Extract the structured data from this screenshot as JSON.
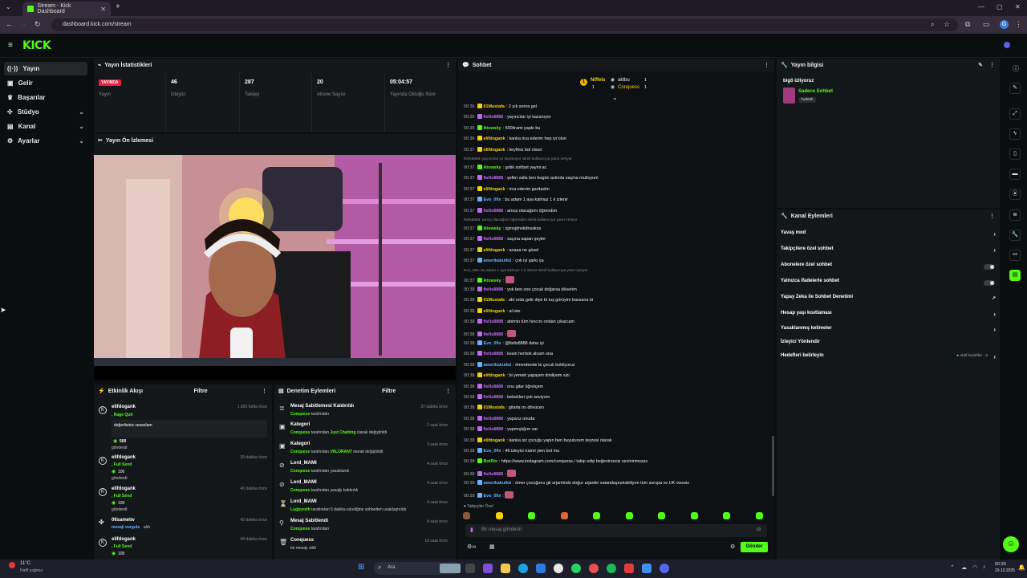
{
  "browser": {
    "tab_title": "Stream - Kick Dashboard",
    "url": "dashboard.kick.com/stream",
    "profile_initial": "G"
  },
  "logo": "KICK",
  "sidebar": {
    "items": [
      {
        "label": "Yayın",
        "icon": "broadcast-icon",
        "active": true
      },
      {
        "label": "Gelir",
        "icon": "wallet-icon"
      },
      {
        "label": "Başarılar",
        "icon": "trophy-icon"
      },
      {
        "label": "Stüdyo",
        "icon": "studio-icon",
        "expandable": true
      },
      {
        "label": "Kanal",
        "icon": "channel-icon",
        "expandable": true
      },
      {
        "label": "Ayarlar",
        "icon": "gear-icon",
        "expandable": true
      }
    ]
  },
  "stats": {
    "title": "Yayın İstatistikleri",
    "items": [
      {
        "value": "YAYINDA",
        "label": "Yayın"
      },
      {
        "value": "46",
        "label": "İzleyici"
      },
      {
        "value": "287",
        "label": "Takipçi"
      },
      {
        "value": "20",
        "label": "Abone Sayısı"
      },
      {
        "value": "05:04:57",
        "label": "Yayında Olduğu Süre"
      }
    ]
  },
  "preview": {
    "title": "Yayın Ön İzlemesi"
  },
  "activity": {
    "title": "Etkinlik Akışı",
    "filter": "Filtre",
    "items": [
      {
        "name": "elifdogank",
        "sub": ", Rage Quit",
        "time": "1.920 hafta önce",
        "msg": "değerlisiniz vesselam",
        "amount": "500",
        "sent": "gönderdi"
      },
      {
        "name": "elifdogank",
        "sub": ", Full Send",
        "time": "39 dakika önce",
        "amount": "100",
        "sent": "gönderdi"
      },
      {
        "name": "elifdogank",
        "sub": ", Full Send",
        "time": "40 dakika önce",
        "amount": "100",
        "sent": "gönderdi"
      },
      {
        "name": "06sametw",
        "sub": "mesaji vurgula",
        "sub2": "aldı",
        "time": "42 dakika önce"
      },
      {
        "name": "elifdogank",
        "sub": ", Full Send",
        "time": "44 dakika önce",
        "amount": "100"
      }
    ]
  },
  "mod": {
    "title": "Denetim Eylemleri",
    "filter": "Filtre",
    "items": [
      {
        "title": "Mesaj Sabitlemesi Kaldırıldı",
        "actor": "Conquess",
        "desc": " tarafından",
        "time": "37 dakika önce"
      },
      {
        "title": "Kategori",
        "actor": "Conquess",
        "desc": " tarafından ",
        "hl": "Just Chatting",
        "desc2": " olarak değiştirildi",
        "time": "1 saat önce"
      },
      {
        "title": "Kategori",
        "actor": "Conquess",
        "desc": " tarafından ",
        "hl": "VALORANT",
        "desc2": " olarak değiştirildi",
        "time": "3 saat önce"
      },
      {
        "title": "Lord_MAMI",
        "actor": "Conquess",
        "desc": " tarafından yasaklandı",
        "time": "4 saat önce"
      },
      {
        "title": "Lord_MAMI",
        "actor": "Conquess",
        "desc": " tarafından yasağı kaldırıldı",
        "time": "4 saat önce"
      },
      {
        "title": "Lord_MAMI",
        "actor": "Lugbureth",
        "desc": " tarafından 5 dakika süreliğine sohbetten uzaklaştırıldı",
        "time": "4 saat önce"
      },
      {
        "title": "Mesaj Sabitlendi",
        "actor": "Conquess",
        "desc": " tarafından",
        "time": "4 saat önce"
      },
      {
        "title": "Conquess",
        "actor": "",
        "desc": "bir mesajı sildi",
        "time": "10 saat önce"
      }
    ]
  },
  "chat": {
    "title": "Sohbet",
    "top_users": [
      {
        "name": "Niffels",
        "count": "1"
      },
      {
        "name": "aktbu",
        "count": "1"
      },
      {
        "name": "Conquess",
        "count": "1"
      }
    ],
    "followers_only_label": "Takipçiler Özel",
    "input_placeholder": "Bir mesaj gönderin",
    "send_label": "Gönder",
    "messages": [
      {
        "ts": "00:36",
        "user": "01Mustafa",
        "color": "#f5d20a",
        "text": "2 yık sonra gel"
      },
      {
        "ts": "00:36",
        "user": "fisfis8888",
        "color": "#c06cf0",
        "text": "yayıncılar iyi kazanıyor"
      },
      {
        "ts": "00:36",
        "user": "Atowsky",
        "color": "#53fc18",
        "text": "500lirami yaplo bu"
      },
      {
        "ts": "00:36",
        "user": "elifdogank",
        "color": "#f5d20a",
        "text": "kanka rica ederim hep iyi olun"
      },
      {
        "ts": "00:37",
        "user": "elifdogank",
        "color": "#f5d20a",
        "text": "keyfiniz bol olsun"
      },
      {
        "reply": "fisfis8888: yayıncılar iyi kazanıyor isimli kullanıcıya yanıt veriyor"
      },
      {
        "ts": "00:37",
        "user": "Atowsky",
        "color": "#53fc18",
        "text": "gotik sohbet yayini ac"
      },
      {
        "ts": "00:37",
        "user": "fisfis8888",
        "color": "#c06cf0",
        "text": "şefim valla ben bugün aslında saçma mutluyum"
      },
      {
        "ts": "00:37",
        "user": "elifdogank",
        "color": "#f5d20a",
        "text": "rica ederim gardaslm"
      },
      {
        "ts": "00:37",
        "user": "Evo_09x",
        "color": "#6ab0ff",
        "text": "bu adam 1 aya kalmaz 1 k izlenir"
      },
      {
        "ts": "00:37",
        "user": "fisfis8888",
        "color": "#c06cf0",
        "text": "amca olacağımı öğrendim"
      },
      {
        "reply": "fisfis8888: amca olacağımı öğrendim isimli kullanıcıya yanıt veriyor"
      },
      {
        "ts": "00:37",
        "user": "Atowsky",
        "color": "#53fc18",
        "text": "zjznsjdnskdnsskns"
      },
      {
        "ts": "00:37",
        "user": "fisfis8888",
        "color": "#c06cf0",
        "text": "saçma sapan şeyler"
      },
      {
        "ts": "00:37",
        "user": "elifdogank",
        "color": "#f5d20a",
        "text": "anaaa ne güzel"
      },
      {
        "ts": "00:37",
        "user": "amerikalıutkü",
        "color": "#6ab0ff",
        "text": "çok iyi şarkı ya"
      },
      {
        "reply": "Evo_09x: bu adam 1 aya kalmaz 1 k izlenir isimli kullanıcıya yanıt veriyor"
      },
      {
        "ts": "00:37",
        "user": "Atowsky",
        "color": "#53fc18",
        "text": ""
      },
      {
        "ts": "00:38",
        "user": "fisfis8888",
        "color": "#c06cf0",
        "text": "yok ben ooo çocuk doğarsa döverim"
      },
      {
        "ts": "00:38",
        "user": "01Mustafa",
        "color": "#f5d20a",
        "text": "abi orda gelir diye bi tuş görüyim bassana bi"
      },
      {
        "ts": "00:38",
        "user": "elifdogank",
        "color": "#f5d20a",
        "text": "al iste"
      },
      {
        "ts": "00:38",
        "user": "fisfis8888",
        "color": "#c06cf0",
        "text": "abimin tüm hıncını ondan çıkarcam"
      },
      {
        "ts": "00:38",
        "user": "fisfis8888",
        "color": "#c06cf0",
        "text": ""
      },
      {
        "ts": "00:38",
        "user": "Evo_09x",
        "color": "#6ab0ff",
        "text": "@fisfis8888 daha iyi"
      },
      {
        "ts": "00:38",
        "user": "fisfis8888",
        "color": "#c06cf0",
        "text": "kesin herbok alcam ona"
      },
      {
        "ts": "00:38",
        "user": "amerikalıutkü",
        "color": "#6ab0ff",
        "text": "ömerdende bi çocuk bekliyoruz"
      },
      {
        "ts": "00:38",
        "user": "elifdogank",
        "color": "#f5d20a",
        "text": "bi yemek yapayım diniliyom sizi"
      },
      {
        "ts": "00:38",
        "user": "fisfis8888",
        "color": "#c06cf0",
        "text": "onu gitar öğretçem"
      },
      {
        "ts": "00:38",
        "user": "fisfis8888",
        "color": "#c06cf0",
        "text": "bebekleri çok seviyom"
      },
      {
        "ts": "00:38",
        "user": "01Mustafa",
        "color": "#f5d20a",
        "text": "gitarla mı dövücen"
      },
      {
        "ts": "00:38",
        "user": "fisfis8888",
        "color": "#c06cf0",
        "text": "yaparız onuda"
      },
      {
        "ts": "00:38",
        "user": "fisfis8888",
        "color": "#c06cf0",
        "text": "yapmışlığım var"
      },
      {
        "ts": "00:38",
        "user": "elifdogank",
        "color": "#f5d20a",
        "text": "kanka siz çocuğu yapın ben buyuturum teyzesi olarak"
      },
      {
        "ts": "00:38",
        "user": "Evo_09x",
        "color": "#6ab0ff",
        "text": "46 izleyici rüami yien bot mu"
      },
      {
        "ts": "00:38",
        "user": "BotRix",
        "color": "#53fc18",
        "text": "https://www.instagram.com/conquess./ takip edip beğenirseniz sevinirimssss"
      },
      {
        "ts": "00:38",
        "user": "fisfis8888",
        "color": "#c06cf0",
        "text": ""
      },
      {
        "ts": "00:39",
        "user": "amerikalıutkü",
        "color": "#6ab0ff",
        "text": "ömer çocuğunu git arjantinde doğur arjantin vatandaşınolabiliyon tüm avrupa ve UK vizesiz"
      },
      {
        "ts": "00:39",
        "user": "Evo_09x",
        "color": "#6ab0ff",
        "text": ""
      }
    ]
  },
  "stream_info": {
    "title": "Yayın bilgisi",
    "stream_title": "bigö izliyoruz",
    "category": "Sadece Sohbet",
    "tag": "Turkish"
  },
  "channel_actions": {
    "title": "Kanal Eylemleri",
    "items": [
      {
        "label": "Yavaş mod",
        "type": "arrow"
      },
      {
        "label": "Takipçilere özel sohbet",
        "type": "arrow"
      },
      {
        "label": "Abonelere özel sohbet",
        "type": "toggle"
      },
      {
        "label": "Yalnızca ifadelerle sohbet",
        "type": "toggle"
      },
      {
        "label": "Yapay Zeka ile Sohbet Denetimi",
        "type": "external"
      },
      {
        "label": "Hesap yaşı kısıtlaması",
        "type": "arrow"
      },
      {
        "label": "Yasaklanmış kelimeler",
        "type": "arrow"
      },
      {
        "label": "İzleyici Yönlendir",
        "type": "none"
      },
      {
        "label": "Hedefleri belirleyin",
        "type": "goal",
        "extra": "Aktif hedefler - 2"
      }
    ]
  },
  "taskbar": {
    "weather_temp": "11°C",
    "weather_desc": "Hafif yağmur",
    "search_label": "Ara",
    "time": "00:39",
    "date": "29.10.2025"
  }
}
